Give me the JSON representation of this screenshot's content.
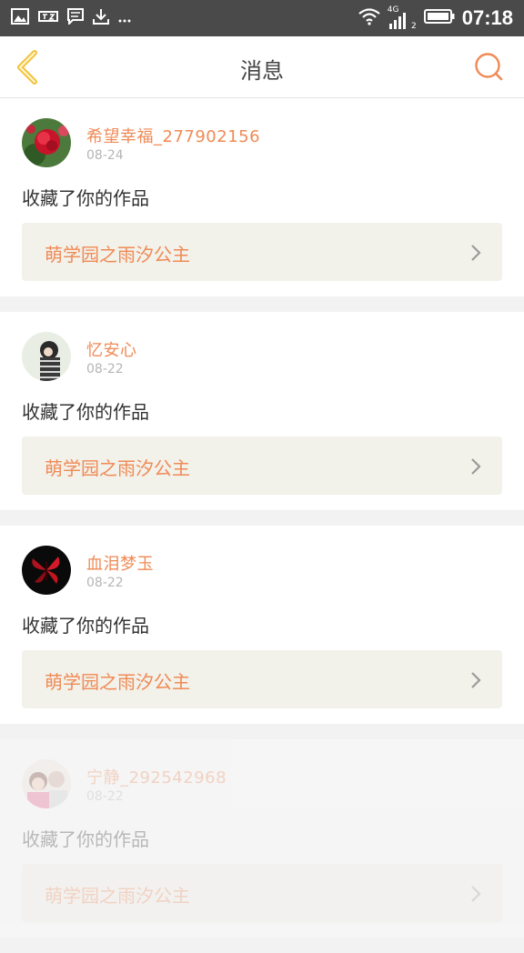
{
  "statusbar": {
    "time": "07:18",
    "network": "4G",
    "sim": "2",
    "left_icons": [
      "image-icon",
      "app-icon",
      "message-icon",
      "download-icon",
      "more-icon"
    ]
  },
  "header": {
    "title": "消息",
    "back_icon": "back-chevron-icon",
    "search_icon": "search-icon"
  },
  "messages": [
    {
      "user": "希望幸福_277902156",
      "date": "08-24",
      "action": "收藏了你的作品",
      "work": "萌学园之雨汐公主"
    },
    {
      "user": "忆安心",
      "date": "08-22",
      "action": "收藏了你的作品",
      "work": "萌学园之雨汐公主"
    },
    {
      "user": "血泪梦玉",
      "date": "08-22",
      "action": "收藏了你的作品",
      "work": "萌学园之雨汐公主"
    },
    {
      "user": "宁静_292542968",
      "date": "08-22",
      "action": "收藏了你的作品",
      "work": "萌学园之雨汐公主"
    }
  ],
  "colors": {
    "accent": "#f08a55",
    "back_icon": "#f2c33a",
    "work_box_bg": "#f2f1ea"
  }
}
